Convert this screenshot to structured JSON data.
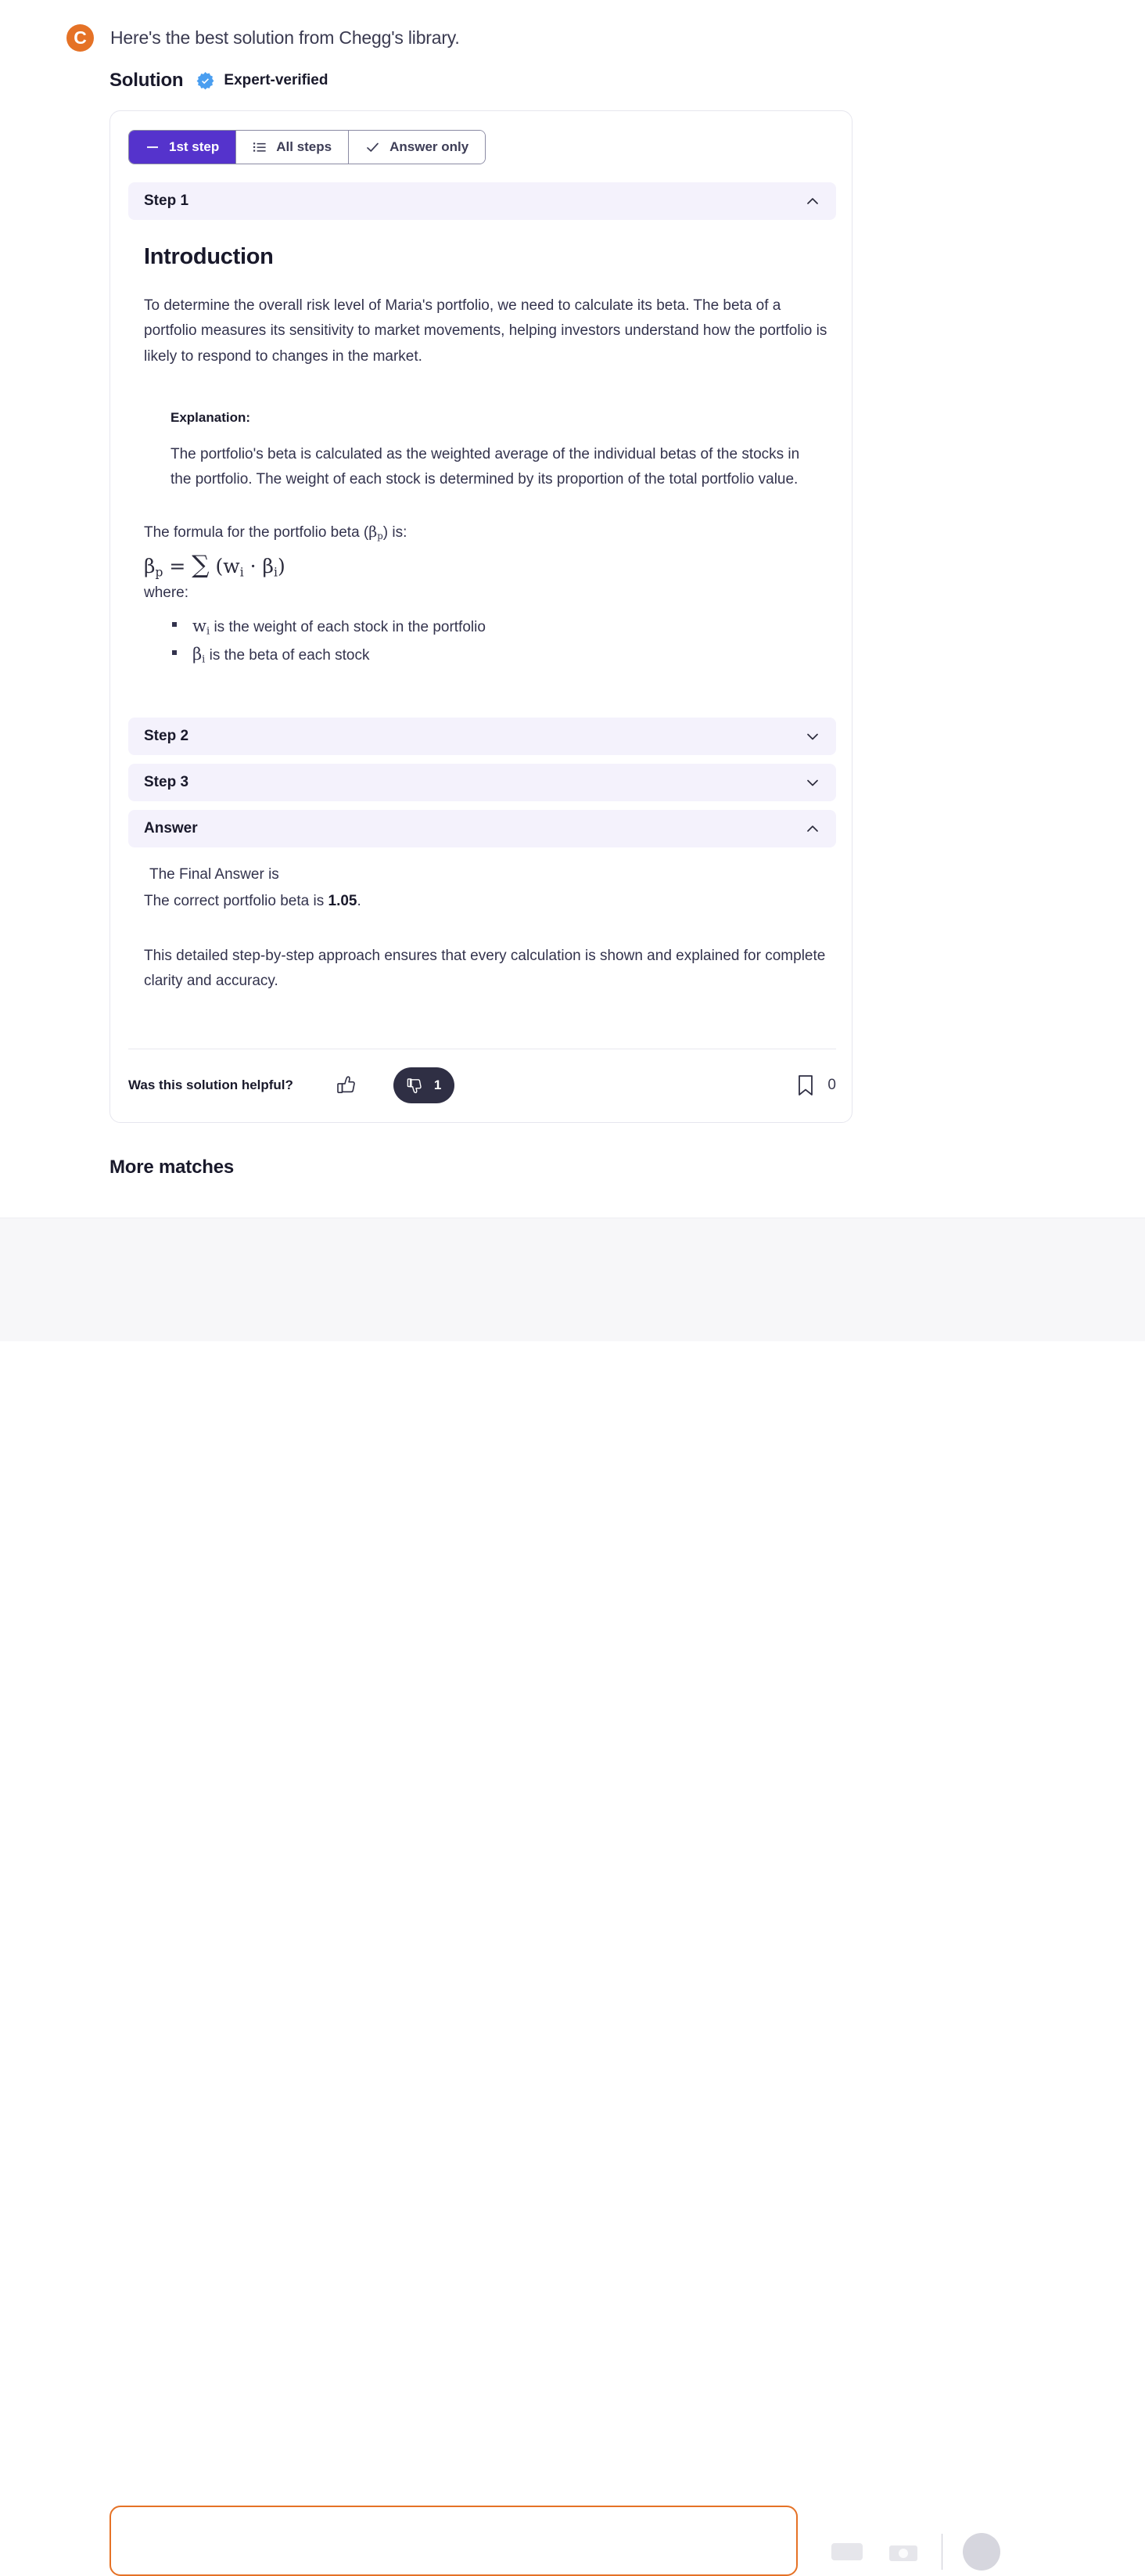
{
  "header": {
    "logo_letter": "C",
    "intro_text": "Here's the best solution from Chegg's library."
  },
  "solution_section": {
    "title": "Solution",
    "verified_label": "Expert-verified"
  },
  "tabs": [
    {
      "label": "1st step",
      "icon": "dash-icon",
      "active": true
    },
    {
      "label": "All steps",
      "icon": "list-icon",
      "active": false
    },
    {
      "label": "Answer only",
      "icon": "check-icon",
      "active": false
    }
  ],
  "accordions": {
    "step1": {
      "label": "Step 1",
      "expanded": true
    },
    "step2": {
      "label": "Step 2",
      "expanded": false
    },
    "step3": {
      "label": "Step 3",
      "expanded": false
    },
    "answer": {
      "label": "Answer",
      "expanded": true
    }
  },
  "step1_content": {
    "heading": "Introduction",
    "paragraph": "To determine the overall risk level of Maria's portfolio, we need to calculate its beta. The beta of a portfolio measures its sensitivity to market movements, helping investors understand how the portfolio is likely to respond to changes in the market.",
    "explanation_title": "Explanation:",
    "explanation_body": "The portfolio's beta is calculated as the weighted average of the individual betas of the stocks in the portfolio. The weight of each stock is determined by its proportion of the total portfolio value.",
    "formula_intro_pre": "The formula for the portfolio beta (",
    "formula_intro_symbol_base": "β",
    "formula_intro_symbol_sub": "p",
    "formula_intro_post": ") is:",
    "formula": "βp = ∑ (wi · βi)",
    "formula_parts": {
      "lhs_base": "β",
      "lhs_sub": "p",
      "equals": "=",
      "sigma": "∑",
      "open_paren": "(",
      "w_base": "w",
      "w_sub": "i",
      "dot": "·",
      "beta_base": "β",
      "beta_sub": "i",
      "close_paren": ")"
    },
    "where_label": "where:",
    "variables": [
      {
        "symbol_base": "w",
        "symbol_sub": "i",
        "description": "is the weight of each stock in the portfolio"
      },
      {
        "symbol_base": "β",
        "symbol_sub": "i",
        "description": "is the beta of each stock"
      }
    ]
  },
  "answer_content": {
    "line1": "The Final Answer is",
    "line2_pre": "The correct portfolio beta is ",
    "line2_value": "1.05",
    "line2_post": ".",
    "closing_paragraph": "This detailed step-by-step approach ensures that every calculation is shown and explained for complete clarity and accuracy."
  },
  "feedback": {
    "question": "Was this solution helpful?",
    "thumbs_up_icon": "thumbs-up-icon",
    "thumbs_down_icon": "thumbs-down-icon",
    "dislike_count": "1",
    "bookmark_icon": "bookmark-icon",
    "bookmark_count": "0"
  },
  "more_matches": {
    "title": "More matches"
  },
  "colors": {
    "chegg_orange": "#e57226",
    "active_tab_purple": "#5533cc",
    "accordion_bg": "#f4f2fc",
    "verified_blue": "#4a9ef0",
    "dark_pill": "#2f2f44",
    "text_dark": "#19192b"
  }
}
